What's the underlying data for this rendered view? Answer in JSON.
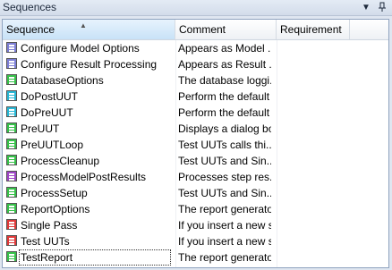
{
  "panel": {
    "title": "Sequences",
    "pin_icon": "pin-icon",
    "menu_icon": "dropdown-arrow-icon"
  },
  "columns": {
    "sequence": "Sequence",
    "comment": "Comment",
    "requirement": "Requirement"
  },
  "rows": [
    {
      "name": "Configure Model Options",
      "comment": "Appears as Model ...",
      "requirement": "",
      "icon": "callback-sequence-icon",
      "icon_color": "#7d7fd6"
    },
    {
      "name": "Configure Result Processing",
      "comment": "Appears as Result ...",
      "requirement": "",
      "icon": "callback-sequence-icon",
      "icon_color": "#7d7fd6"
    },
    {
      "name": "DatabaseOptions",
      "comment": "The database loggi...",
      "requirement": "",
      "icon": "sequence-icon",
      "icon_color": "#37c24a"
    },
    {
      "name": "DoPostUUT",
      "comment": "Perform the default ...",
      "requirement": "",
      "icon": "callback-sequence-icon",
      "icon_color": "#28b8d6"
    },
    {
      "name": "DoPreUUT",
      "comment": "Perform the default ...",
      "requirement": "",
      "icon": "callback-sequence-icon",
      "icon_color": "#28b8d6"
    },
    {
      "name": "PreUUT",
      "comment": "Displays a dialog bo...",
      "requirement": "",
      "icon": "sequence-icon",
      "icon_color": "#37c24a"
    },
    {
      "name": "PreUUTLoop",
      "comment": "Test UUTs calls thi...",
      "requirement": "",
      "icon": "sequence-icon",
      "icon_color": "#37c24a"
    },
    {
      "name": "ProcessCleanup",
      "comment": "Test UUTs and Sin...",
      "requirement": "",
      "icon": "sequence-icon",
      "icon_color": "#37c24a"
    },
    {
      "name": "ProcessModelPostResults",
      "comment": "Processes step res...",
      "requirement": "",
      "icon": "callback-sequence-icon",
      "icon_color": "#a046c8"
    },
    {
      "name": "ProcessSetup",
      "comment": "Test UUTs and Sin...",
      "requirement": "",
      "icon": "sequence-icon",
      "icon_color": "#37c24a"
    },
    {
      "name": "ReportOptions",
      "comment": "The report generato...",
      "requirement": "",
      "icon": "sequence-icon",
      "icon_color": "#37c24a"
    },
    {
      "name": "Single Pass",
      "comment": "If you insert a new s...",
      "requirement": "",
      "icon": "entry-point-icon",
      "icon_color": "#e03a3a"
    },
    {
      "name": "Test UUTs",
      "comment": "If you insert a new s...",
      "requirement": "",
      "icon": "entry-point-icon",
      "icon_color": "#e03a3a"
    },
    {
      "name": "TestReport",
      "comment": "The report generato...",
      "requirement": "",
      "icon": "sequence-icon",
      "icon_color": "#37c24a",
      "selected": true
    }
  ]
}
